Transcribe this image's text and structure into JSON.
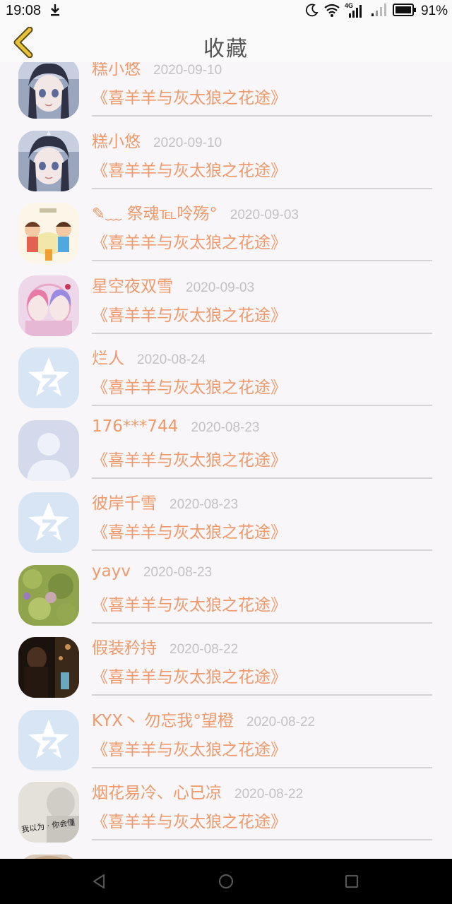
{
  "status_bar": {
    "time": "19:08",
    "network_label": "4G",
    "battery_text": "91%"
  },
  "header": {
    "title": "收藏"
  },
  "favorites": [
    {
      "username": "糕小悠",
      "date": "2020-09-10",
      "title": "《喜羊羊与灰太狼之花途》",
      "avatar": "anime-girl"
    },
    {
      "username": "糕小悠",
      "date": "2020-09-10",
      "title": "《喜羊羊与灰太狼之花途》",
      "avatar": "anime-girl"
    },
    {
      "username": "✎﹏ 祭魂℡呤殇°",
      "date": "2020-09-03",
      "title": "《喜羊羊与灰太狼之花途》",
      "avatar": "cartoon-kids"
    },
    {
      "username": "星空夜双雪",
      "date": "2020-09-03",
      "title": "《喜羊羊与灰太狼之花途》",
      "avatar": "anime-twins"
    },
    {
      "username": "烂人",
      "date": "2020-08-24",
      "title": "《喜羊羊与灰太狼之花途》",
      "avatar": "qzone-default"
    },
    {
      "username": "176***744",
      "date": "2020-08-23",
      "title": "《喜羊羊与灰太狼之花途》",
      "avatar": "default-person"
    },
    {
      "username": "彼岸千雪",
      "date": "2020-08-23",
      "title": "《喜羊羊与灰太狼之花途》",
      "avatar": "qzone-default"
    },
    {
      "username": "yayv",
      "date": "2020-08-23",
      "title": "《喜羊羊与灰太狼之花途》",
      "avatar": "green-texture"
    },
    {
      "username": "假装矜持",
      "date": "2020-08-22",
      "title": "《喜羊羊与灰太狼之花途》",
      "avatar": "dark-photo"
    },
    {
      "username": "KYX丶 勿忘我°望橙",
      "date": "2020-08-22",
      "title": "《喜羊羊与灰太狼之花途》",
      "avatar": "qzone-default"
    },
    {
      "username": "烟花易冷、心已凉",
      "date": "2020-08-22",
      "title": "《喜羊羊与灰太狼之花途》",
      "avatar": "handwriting-photo",
      "avatar_text": "我以为 · 你会懂"
    },
    {
      "username": "",
      "date": "",
      "title": "",
      "avatar": "partial-photo"
    }
  ],
  "colors": {
    "accent": "#ee9a6d",
    "date": "#c4c0c4",
    "divider": "#d6d2d6",
    "background": "#f8f6f8",
    "back_arrow": "#e8c23a"
  }
}
